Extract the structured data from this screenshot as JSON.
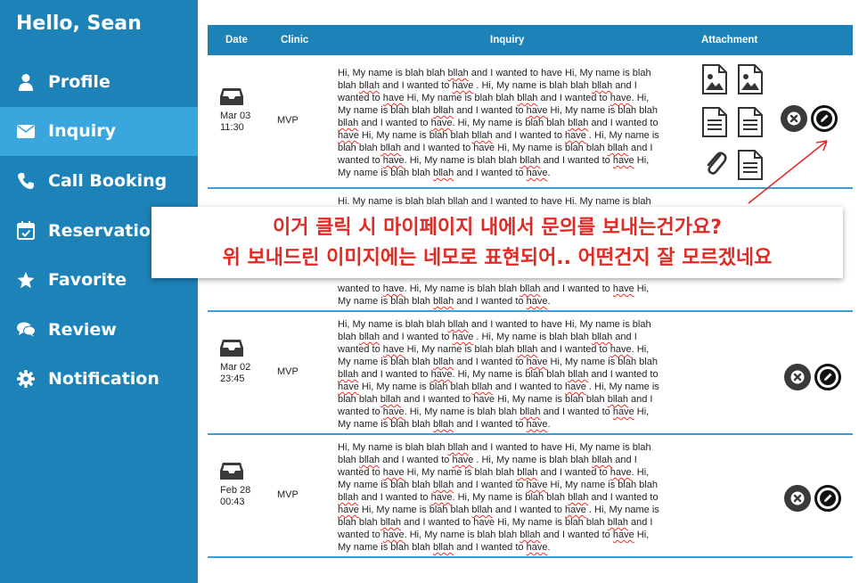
{
  "sidebar": {
    "greeting": "Hello, Sean",
    "items": [
      {
        "label": "Profile",
        "icon": "user-icon"
      },
      {
        "label": "Inquiry",
        "icon": "envelope-icon",
        "active": true
      },
      {
        "label": "Call Booking",
        "icon": "phone-icon"
      },
      {
        "label": "Reservation",
        "icon": "calendar-check-icon"
      },
      {
        "label": "Favorite",
        "icon": "star-icon"
      },
      {
        "label": "Review",
        "icon": "chat-bubbles-icon"
      },
      {
        "label": "Notification",
        "icon": "gear-icon"
      }
    ]
  },
  "table": {
    "headers": {
      "date": "Date",
      "clinic": "Clinic",
      "inquiry": "Inquiry",
      "attachment": "Attachment"
    },
    "rows": [
      {
        "date": "Mar 03",
        "time": "11:30",
        "clinic": "MVP",
        "attachments": [
          "image",
          "image",
          "document",
          "document",
          "paperclip",
          "document"
        ]
      },
      {
        "date": "",
        "time": "",
        "clinic": "",
        "attachments": []
      },
      {
        "date": "Mar 02",
        "time": "23:45",
        "clinic": "MVP",
        "attachments": []
      },
      {
        "date": "Feb 28",
        "time": "00:43",
        "clinic": "MVP",
        "attachments": []
      }
    ],
    "inquiry_lines": [
      [
        "Hi, My name is blah blah ",
        "bllah",
        " and I wanted to have Hi, My name is blah"
      ],
      [
        "blah ",
        "bllah",
        " and I wanted to ",
        "have",
        " . Hi, My name is blah blah ",
        "bllah",
        " and I"
      ],
      [
        "wanted to ",
        "have",
        " Hi, My name is blah blah ",
        "bllah",
        " and I wanted to ",
        "have",
        ". Hi,"
      ],
      [
        "My name is blah blah ",
        "bllah",
        " and I wanted to ",
        "have",
        " Hi, My name is blah blah"
      ],
      [
        "bllah",
        " and I wanted to ",
        "have",
        ". Hi, My name is blah blah ",
        "bllah",
        " and I wanted to"
      ],
      [
        "have",
        " Hi, My name is blah blah ",
        "bllah",
        " and I wanted to ",
        "have",
        " . Hi, My name is"
      ],
      [
        "blah blah ",
        "bllah",
        " and I wanted to have Hi, My name is blah blah ",
        "bllah",
        " and I"
      ],
      [
        "wanted to ",
        "have",
        ". Hi, My name is blah blah ",
        "bllah",
        " and I wanted to ",
        "have",
        " Hi,"
      ],
      [
        "My name is blah blah ",
        "bllah",
        " and I wanted to ",
        "have",
        "."
      ]
    ],
    "row2_visible_lines": [
      [
        "Hi. My name is blah blah ",
        "bllah",
        " and I wanted to have Hi. My name is blah"
      ],
      [
        "wanted to ",
        "have",
        ". Hi, My name is blah blah ",
        "bllah",
        " and I wanted to ",
        "have",
        " Hi,"
      ],
      [
        "My name is blah blah ",
        "bllah",
        " and I wanted to ",
        "have",
        "."
      ]
    ]
  },
  "annotation": {
    "line1": "이거 클릭 시 마이페이지 내에서 문의를 보내는건가요?",
    "line2": "위 보내드린 이미지에는 네모로 표현되어.. 어떤건지 잘 모르겠네요",
    "color": "#e12a24"
  },
  "colors": {
    "sidebar": "#1c82b8",
    "active": "#3aa6de",
    "divider": "#3c9ed3"
  }
}
